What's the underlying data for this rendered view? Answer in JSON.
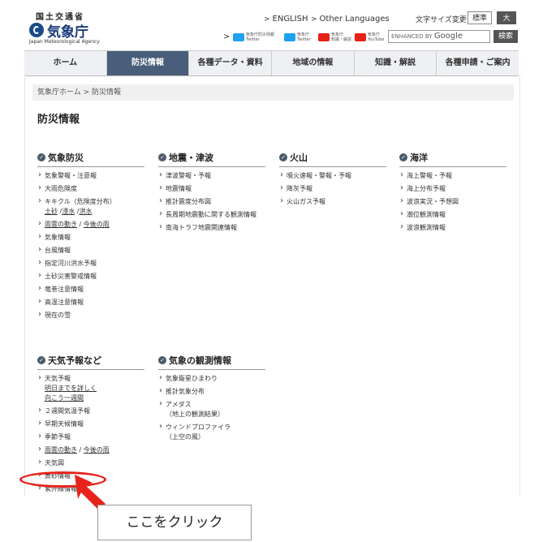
{
  "header": {
    "org_small": "国土交通省",
    "org_main": "気象庁",
    "org_en": "Japan Meteorological Agency",
    "english_link": "ENGLISH",
    "other_languages_link": "Other Languages",
    "font_size_label": "文字サイズ変更",
    "font_size_standard": "標準",
    "font_size_large": "大",
    "social": [
      {
        "icon": "twitter-icon",
        "label": "気象庁防災情報\nTwitter",
        "color": "#1da1f2"
      },
      {
        "icon": "twitter-icon",
        "label": "気象庁\nTwitter",
        "color": "#1da1f2"
      },
      {
        "icon": "youtube-icon",
        "label": "気象庁\n知識・解説",
        "color": "#e62117"
      },
      {
        "icon": "youtube-icon",
        "label": "気象庁\nYouTube",
        "color": "#e62117"
      }
    ],
    "search_placeholder_prefix": "ENHANCED BY",
    "search_placeholder_brand": "Google",
    "search_button": "検索"
  },
  "gnav": [
    "ホーム",
    "防災情報",
    "各種データ・資料",
    "地域の情報",
    "知識・解説",
    "各種申請・ご案内"
  ],
  "gnav_active": "防災情報",
  "breadcrumb": {
    "home": "気象庁ホーム",
    "sep": ">",
    "current": "防災情報"
  },
  "page_title": "防災情報",
  "sections": {
    "kisho_bosai": {
      "title": "気象防災",
      "items": [
        "気象警報・注意報",
        "大雨危険度",
        "キキクル（危険度分布）",
        "雨雲の動き",
        "今後の雨",
        "気象情報",
        "台風情報",
        "指定河川洪水予報",
        "土砂災害警戒情報",
        "竜巻注意情報",
        "高温注意情報",
        "現在の雪"
      ],
      "kikikuru_sub": [
        "土砂",
        "浸水",
        "洪水"
      ]
    },
    "jishin": {
      "title": "地震・津波",
      "items": [
        "津波警報・予報",
        "地震情報",
        "推計震度分布図",
        "長周期地震動に関する観測情報",
        "南海トラフ地震関連情報"
      ]
    },
    "kazan": {
      "title": "火山",
      "items": [
        "噴火速報・警報・予報",
        "降灰予報",
        "火山ガス予報"
      ]
    },
    "kaiyo": {
      "title": "海洋",
      "items": [
        "海上警報・予報",
        "海上分布予報",
        "波浪実況・予想図",
        "潮位観測情報",
        "波浪観測情報"
      ]
    },
    "tenki": {
      "title": "天気予報など",
      "items": [
        "天気予報",
        "明日までを詳しく",
        "向こう一週間",
        "２週間気温予報",
        "早期天候情報",
        "季節予報",
        "雨雲の動き",
        "今後の雨",
        "天気図",
        "黄砂情報",
        "紫外線情報"
      ]
    },
    "kansoku": {
      "title": "気象の観測情報",
      "items": [
        "気象衛星ひまわり",
        "推計気象分布",
        "アメダス",
        "（地上の観測結果）",
        "ウィンドプロファイラ",
        "（上空の風）"
      ]
    }
  },
  "callout_text": "ここをクリック",
  "colors": {
    "nav_active": "#495e7a",
    "highlight": "#e8231b"
  }
}
